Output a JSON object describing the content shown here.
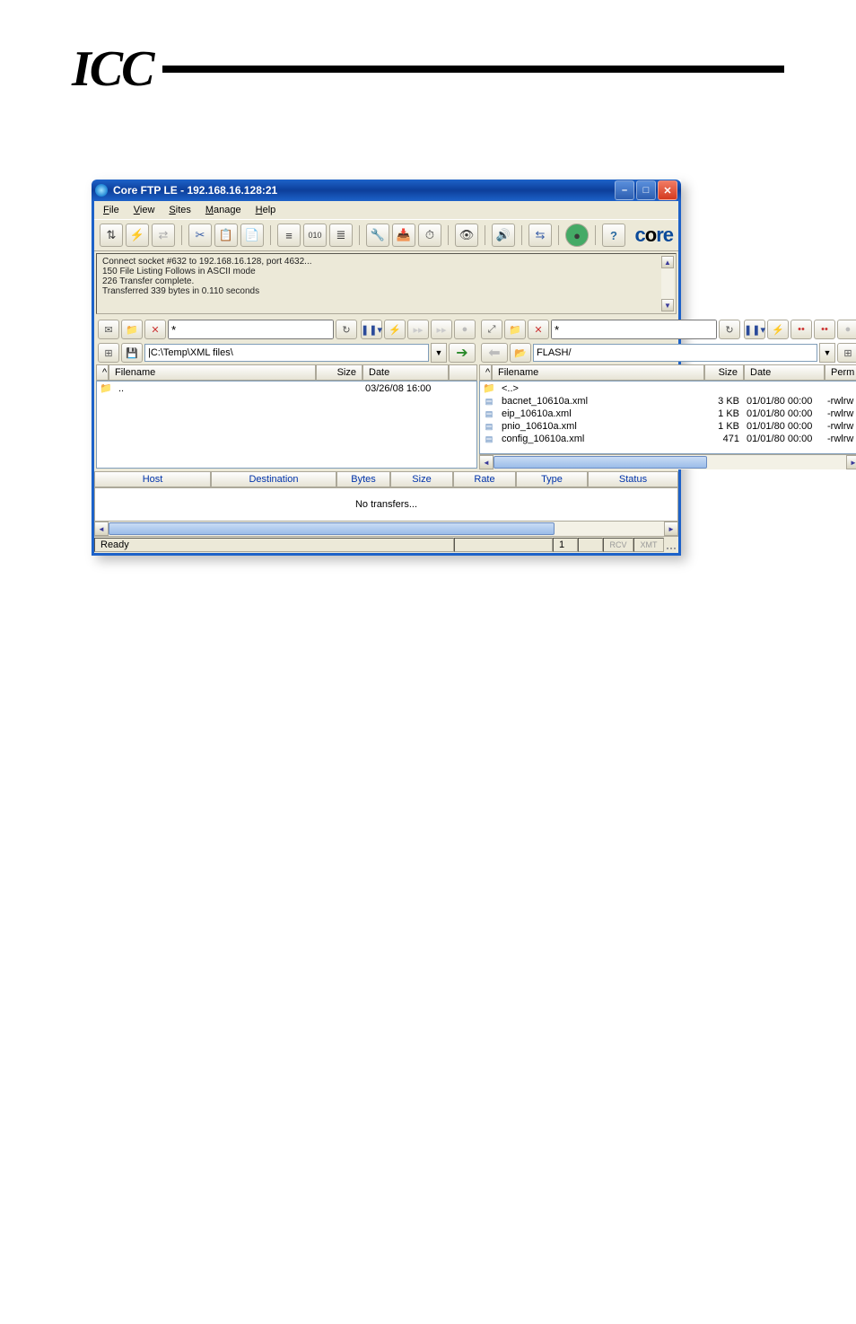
{
  "logo": "ICC",
  "window": {
    "title": "Core FTP LE - 192.168.16.128:21"
  },
  "menu": [
    "File",
    "View",
    "Sites",
    "Manage",
    "Help"
  ],
  "brand": "core",
  "log": [
    "Connect socket #632 to 192.168.16.128, port 4632...",
    "150 File Listing Follows in ASCII mode",
    "226 Transfer complete.",
    "Transferred 339 bytes in 0.110 seconds"
  ],
  "local": {
    "filter": "*",
    "path": "|C:\\Temp\\XML files\\",
    "cols": {
      "filename": "Filename",
      "size": "Size",
      "date": "Date"
    },
    "rows": [
      {
        "name": "..",
        "size": "",
        "date": "03/26/08 16:00",
        "type": "folder"
      }
    ]
  },
  "remote": {
    "filter": "*",
    "path": "FLASH/",
    "cols": {
      "filename": "Filename",
      "size": "Size",
      "date": "Date",
      "perm": "Perm"
    },
    "rows": [
      {
        "name": "<..>",
        "size": "",
        "date": "",
        "perm": "",
        "type": "folder"
      },
      {
        "name": "bacnet_10610a.xml",
        "size": "3 KB",
        "date": "01/01/80 00:00",
        "perm": "-rwlrw",
        "type": "xml"
      },
      {
        "name": "eip_10610a.xml",
        "size": "1 KB",
        "date": "01/01/80 00:00",
        "perm": "-rwlrw",
        "type": "xml"
      },
      {
        "name": "pnio_10610a.xml",
        "size": "1 KB",
        "date": "01/01/80 00:00",
        "perm": "-rwlrw",
        "type": "xml"
      },
      {
        "name": "config_10610a.xml",
        "size": "471",
        "date": "01/01/80 00:00",
        "perm": "-rwlrw",
        "type": "xml"
      }
    ]
  },
  "transfer": {
    "cols": [
      "Host",
      "Destination",
      "Bytes",
      "Size",
      "Rate",
      "Type",
      "Status"
    ],
    "empty": "No transfers..."
  },
  "status": {
    "ready": "Ready",
    "count": "1",
    "rcv": "RCV",
    "xmt": "XMT"
  }
}
